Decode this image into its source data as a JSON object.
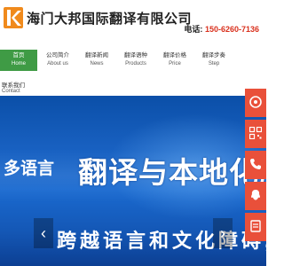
{
  "header": {
    "company_name": "海门大邦国际翻译有限公司",
    "phone_label": "电话:",
    "phone_number": "150-6260-7136"
  },
  "nav": {
    "items": [
      {
        "cn": "首页",
        "en": "Home",
        "active": true
      },
      {
        "cn": "公司简介",
        "en": "About us"
      },
      {
        "cn": "翻译新闻",
        "en": "News"
      },
      {
        "cn": "翻译语种",
        "en": "Products"
      },
      {
        "cn": "翻译价格",
        "en": "Price"
      },
      {
        "cn": "翻译步奏",
        "en": "Step"
      },
      {
        "cn": "联系我们",
        "en": "Contact"
      }
    ]
  },
  "banner": {
    "line1_small": "多语言",
    "line1_large": "翻译与本地化服",
    "line2": "跨越语言和文化障碍,"
  },
  "controls": {
    "prev": "‹",
    "next": "›"
  },
  "side_icons": [
    "target-icon",
    "qr-code-icon",
    "phone-icon",
    "chat-icon",
    "notepad-icon"
  ],
  "colors": {
    "accent_green": "#3f9b45",
    "accent_red": "#e9503a",
    "logo_orange": "#f08a1c",
    "banner_blue": "#1a6ad0"
  }
}
